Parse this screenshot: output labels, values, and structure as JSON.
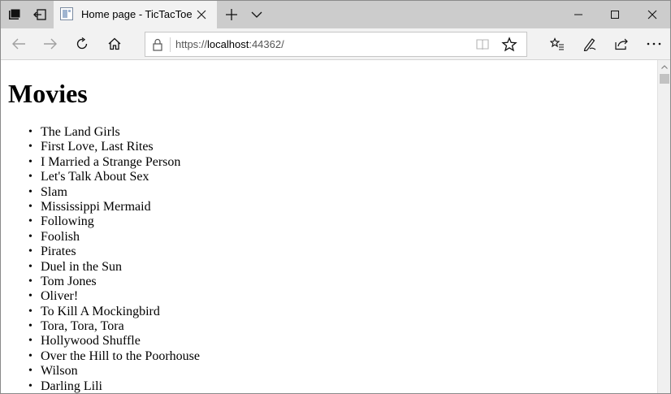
{
  "tab": {
    "title": "Home page - TicTacToe"
  },
  "address": {
    "scheme": "https://",
    "host": "localhost",
    "port": ":44362/"
  },
  "page": {
    "heading": "Movies",
    "movies": [
      "The Land Girls",
      "First Love, Last Rites",
      "I Married a Strange Person",
      "Let's Talk About Sex",
      "Slam",
      "Mississippi Mermaid",
      "Following",
      "Foolish",
      "Pirates",
      "Duel in the Sun",
      "Tom Jones",
      "Oliver!",
      "To Kill A Mockingbird",
      "Tora, Tora, Tora",
      "Hollywood Shuffle",
      "Over the Hill to the Poorhouse",
      "Wilson",
      "Darling Lili"
    ]
  }
}
